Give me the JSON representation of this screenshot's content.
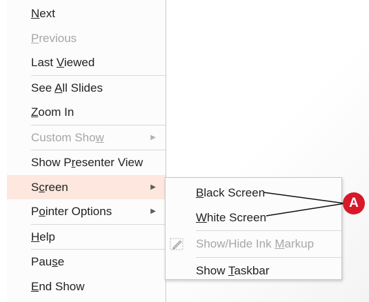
{
  "main_menu": {
    "items": [
      {
        "pre": "",
        "u": "N",
        "post": "ext",
        "disabled": false
      },
      {
        "pre": "",
        "u": "P",
        "post": "revious",
        "disabled": true
      },
      {
        "pre": "Last ",
        "u": "V",
        "post": "iewed",
        "disabled": false
      },
      {
        "pre": "See ",
        "u": "A",
        "post": "ll Slides",
        "disabled": false
      },
      {
        "pre": "",
        "u": "Z",
        "post": "oom In",
        "disabled": false
      },
      {
        "pre": "Custom Sho",
        "u": "w",
        "post": "",
        "disabled": true
      },
      {
        "pre": "Show P",
        "u": "r",
        "post": "esenter View",
        "disabled": false
      },
      {
        "pre": "S",
        "u": "c",
        "post": "reen",
        "disabled": false
      },
      {
        "pre": "P",
        "u": "o",
        "post": "inter Options",
        "disabled": false
      },
      {
        "pre": "",
        "u": "H",
        "post": "elp",
        "disabled": false
      },
      {
        "pre": "Pau",
        "u": "s",
        "post": "e",
        "disabled": false
      },
      {
        "pre": "",
        "u": "E",
        "post": "nd Show",
        "disabled": false
      }
    ]
  },
  "screen_submenu": {
    "items": [
      {
        "pre": "",
        "u": "B",
        "post": "lack Screen",
        "disabled": false
      },
      {
        "pre": "",
        "u": "W",
        "post": "hite Screen",
        "disabled": false
      },
      {
        "pre": "Show/Hide Ink ",
        "u": "M",
        "post": "arkup",
        "disabled": true
      },
      {
        "pre": "Show ",
        "u": "T",
        "post": "askbar",
        "disabled": false
      }
    ]
  },
  "icons": {
    "submenu_arrow": "chevron-right-icon",
    "ink_markup": "ink-markup-icon"
  },
  "callout": {
    "label": "A",
    "color": "#d7192a"
  },
  "colors": {
    "highlight": "#fde7df",
    "disabled_text": "#a6a6a6"
  }
}
